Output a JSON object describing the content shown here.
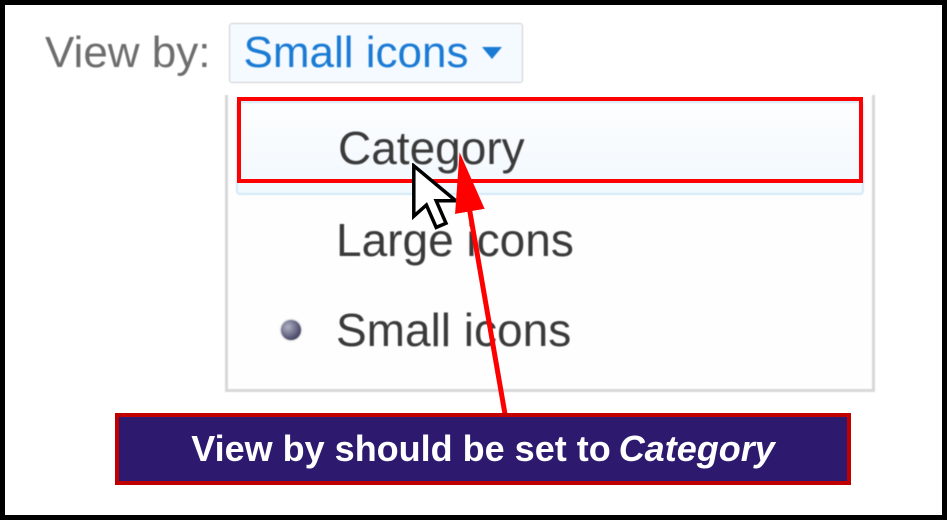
{
  "header": {
    "view_by_label": "View by:",
    "dropdown_value": "Small icons"
  },
  "menu": {
    "items": [
      {
        "label": "Category",
        "selected": false,
        "highlighted": true
      },
      {
        "label": "Large icons",
        "selected": false,
        "highlighted": false
      },
      {
        "label": "Small icons",
        "selected": true,
        "highlighted": false
      }
    ]
  },
  "annotation": {
    "callout_text": "View by should be set to",
    "callout_emph": "Category",
    "highlight_color": "#ff0000",
    "callout_bg": "#2d1a6e",
    "callout_border": "#c00000"
  }
}
